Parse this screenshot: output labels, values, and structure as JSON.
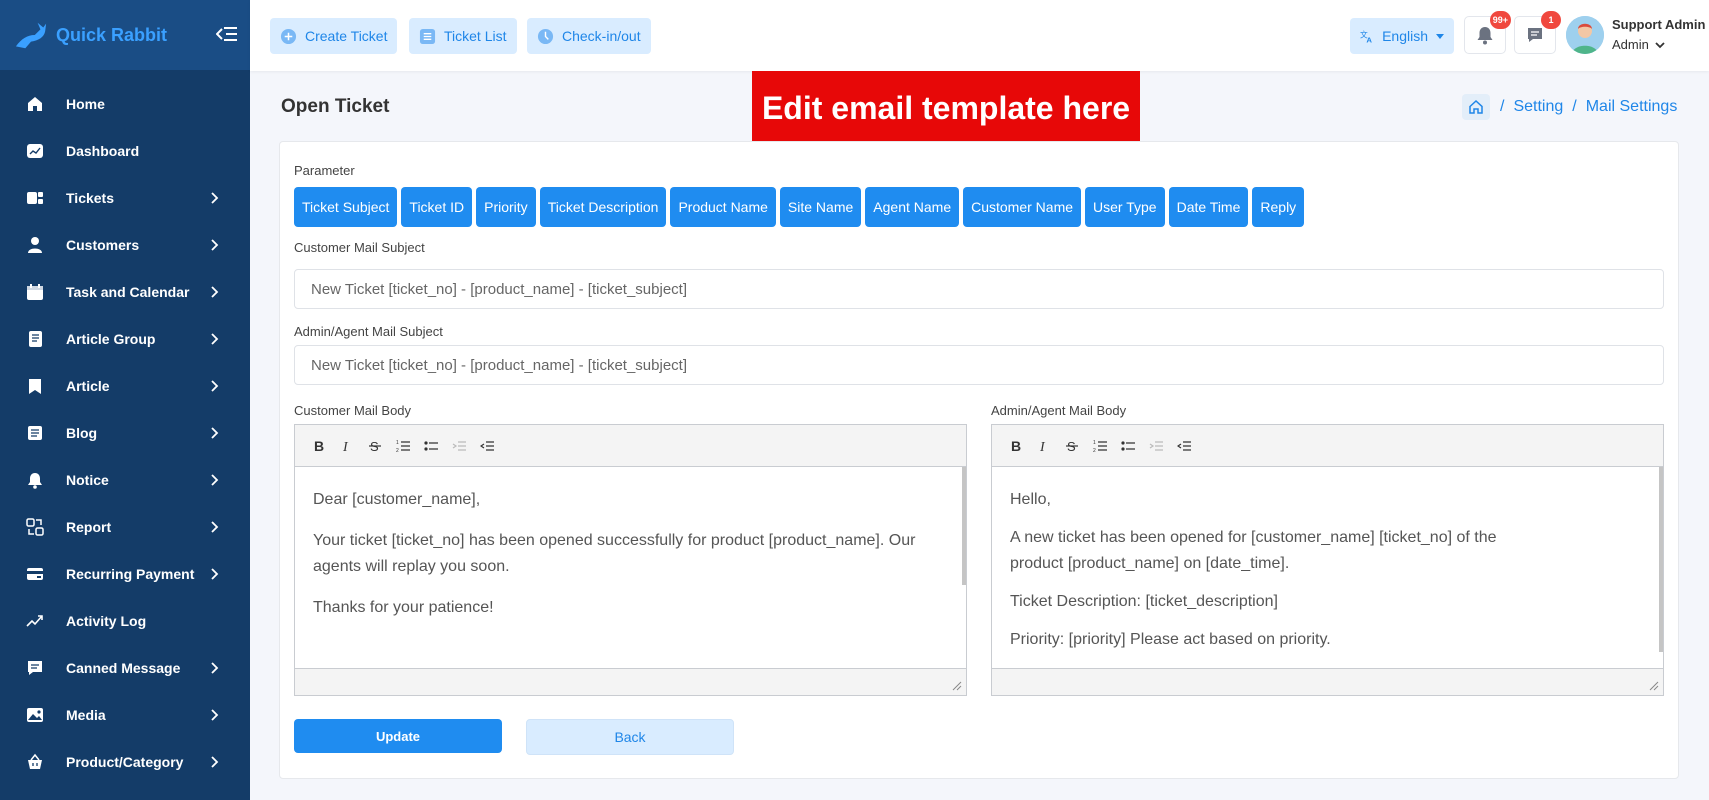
{
  "brand": {
    "name": "Quick Rabbit"
  },
  "sidebar": {
    "items": [
      {
        "label": "Home",
        "icon": "home-icon",
        "chevron": false
      },
      {
        "label": "Dashboard",
        "icon": "dashboard-icon",
        "chevron": false
      },
      {
        "label": "Tickets",
        "icon": "tickets-icon",
        "chevron": true
      },
      {
        "label": "Customers",
        "icon": "user-icon",
        "chevron": true
      },
      {
        "label": "Task and Calendar",
        "icon": "calendar-icon",
        "chevron": true
      },
      {
        "label": "Article Group",
        "icon": "article-group-icon",
        "chevron": true
      },
      {
        "label": "Article",
        "icon": "bookmark-icon",
        "chevron": true
      },
      {
        "label": "Blog",
        "icon": "blog-icon",
        "chevron": true
      },
      {
        "label": "Notice",
        "icon": "bell-icon",
        "chevron": true
      },
      {
        "label": "Report",
        "icon": "report-icon",
        "chevron": true
      },
      {
        "label": "Recurring Payment",
        "icon": "payment-icon",
        "chevron": true
      },
      {
        "label": "Activity Log",
        "icon": "activity-icon",
        "chevron": false
      },
      {
        "label": "Canned Message",
        "icon": "message-icon",
        "chevron": true
      },
      {
        "label": "Media",
        "icon": "image-icon",
        "chevron": true
      },
      {
        "label": "Product/Category",
        "icon": "basket-icon",
        "chevron": true
      }
    ]
  },
  "topbar": {
    "create_ticket": "Create Ticket",
    "ticket_list": "Ticket List",
    "check_in_out": "Check-in/out",
    "language": "English",
    "notifications_badge": "99+",
    "messages_badge": "1",
    "user_name": "Support Admin",
    "user_role": "Admin"
  },
  "page": {
    "title": "Open Ticket",
    "overlay_text": "Edit email template here",
    "breadcrumb": [
      "Setting",
      "Mail Settings"
    ]
  },
  "form": {
    "parameter_label": "Parameter",
    "parameters": [
      "Ticket Subject",
      "Ticket ID",
      "Priority",
      "Ticket Description",
      "Product Name",
      "Site Name",
      "Agent Name",
      "Customer Name",
      "User Type",
      "Date Time",
      "Reply"
    ],
    "customer_subject_label": "Customer Mail Subject",
    "customer_subject_value": "New Ticket [ticket_no] - [product_name] - [ticket_subject]",
    "admin_subject_label": "Admin/Agent Mail Subject",
    "admin_subject_value": "New Ticket [ticket_no] - [product_name] - [ticket_subject]",
    "customer_body_label": "Customer Mail Body",
    "customer_body": [
      "Dear [customer_name],",
      "Your ticket [ticket_no] has been opened successfully for product [product_name]. Our agents will replay you soon.",
      "Thanks for your patience!"
    ],
    "admin_body_label": "Admin/Agent Mail Body",
    "admin_body": [
      "Hello,",
      "A new ticket has been opened for [customer_name] [ticket_no] of the product [product_name] on [date_time].",
      "Ticket Description: [ticket_description]",
      "Priority: [priority] Please act based on priority."
    ],
    "update_label": "Update",
    "back_label": "Back"
  },
  "colors": {
    "sidebar": "#143c68",
    "accent": "#1f8cf0",
    "overlay": "#e70808"
  }
}
